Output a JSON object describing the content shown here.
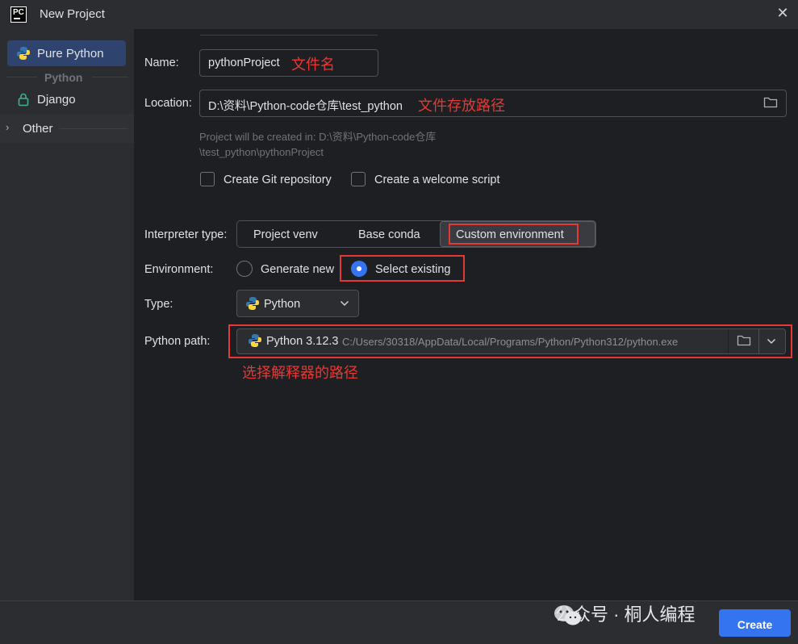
{
  "window": {
    "title": "New Project",
    "logo_text": "PC"
  },
  "sidebar": {
    "items": [
      {
        "label": "Pure Python",
        "selected": true
      },
      {
        "label": "Django"
      },
      {
        "label": "Other"
      }
    ],
    "group_label": "Python"
  },
  "form": {
    "name_label": "Name:",
    "name_value": "pythonProject",
    "name_note": "文件名",
    "location_label": "Location:",
    "location_value": "D:\\资料\\Python-code仓库\\test_python",
    "location_note": "文件存放路径",
    "hint_line1": "Project will be created in: D:\\资料\\Python-code仓库",
    "hint_line2": "\\test_python\\pythonProject",
    "git_checkbox": {
      "label": "Create Git repository",
      "checked": false
    },
    "welcome_checkbox": {
      "label": "Create a welcome script",
      "checked": false
    },
    "interpreter_type_label": "Interpreter type:",
    "interpreter_types": [
      "Project venv",
      "Base conda",
      "Custom environment"
    ],
    "interpreter_selected": "Custom environment",
    "environment_label": "Environment:",
    "env_options": [
      "Generate new",
      "Select existing"
    ],
    "env_selected": "Select existing",
    "type_label": "Type:",
    "type_value": "Python",
    "python_path_label": "Python path:",
    "python_version": "Python 3.12.3",
    "python_path": "C:/Users/30318/AppData/Local/Programs/Python/Python312/python.exe",
    "path_note": "选择解释器的路径"
  },
  "footer": {
    "create_label": "Create",
    "watermark": "公众号 · 桐人编程"
  },
  "colors": {
    "accent": "#3574f0",
    "annotation_red": "#e53935",
    "python_blue": "#3776ab",
    "python_yellow": "#ffd43b"
  }
}
